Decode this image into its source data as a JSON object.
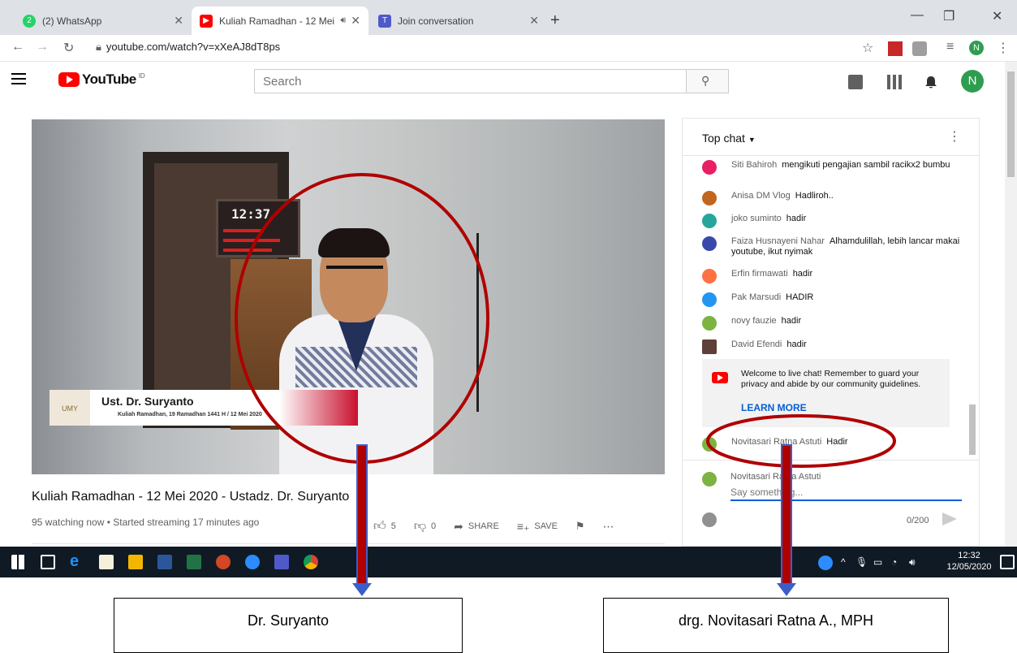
{
  "browser": {
    "tabs": [
      {
        "label": "(2) WhatsApp",
        "badge": "2"
      },
      {
        "label": "Kuliah Ramadhan - 12 Mei 2("
      },
      {
        "label": "Join conversation"
      }
    ],
    "url": "youtube.com/watch?v=xXeAJ8dT8ps",
    "profile_initial": "N"
  },
  "youtube": {
    "logo_text": "YouTube",
    "logo_region": "ID",
    "search_placeholder": "Search",
    "avatar_initial": "N"
  },
  "video": {
    "lower_third_name": "Ust. Dr. Suryanto",
    "lower_third_sub": "Kuliah Ramadhan, 19 Ramadhan 1441 H / 12 Mei 2020",
    "clock_text": "12:37",
    "badge_text": "UMY",
    "title": "Kuliah Ramadhan - 12 Mei 2020 - Ustadz. Dr. Suryanto",
    "meta": "95 watching now • Started streaming 17 minutes ago",
    "likes": "5",
    "dislikes": "0",
    "share_label": "SHARE",
    "save_label": "SAVE"
  },
  "chat": {
    "header": "Top chat",
    "messages": [
      {
        "author": "Siti Bahiroh",
        "text": "mengikuti pengajian sambil racikx2 bumbu",
        "color": "#e91e63"
      },
      {
        "author": "Anisa DM Vlog",
        "text": "Hadliroh..",
        "color": "#c1661f"
      },
      {
        "author": "joko suminto",
        "text": "hadir",
        "color": "#26a69a"
      },
      {
        "author": "Faiza Husnayeni Nahar",
        "text": "Alhamdulillah, lebih lancar makai youtube, ikut nyimak",
        "color": "#3949ab"
      },
      {
        "author": "Erfin firmawati",
        "text": "hadir",
        "color": "#ff7043"
      },
      {
        "author": "Pak Marsudi",
        "text": "HADIR",
        "color": "#2196f3"
      },
      {
        "author": "novy fauzie",
        "text": "hadir",
        "color": "#7cb342"
      },
      {
        "author": "David Efendi",
        "text": "hadir",
        "color": "#5d4037"
      },
      {
        "author": "Novitasari Ratna Astuti",
        "text": "Hadir",
        "color": "#7cb342"
      }
    ],
    "welcome_text": "Welcome to live chat! Remember to guard your privacy and abide by our community guidelines.",
    "learn_more": "LEARN MORE",
    "compose_user": "Novitasari Ratna Astuti",
    "compose_placeholder": "Say something...",
    "char_count": "0/200"
  },
  "taskbar": {
    "time": "12:32",
    "date": "12/05/2020"
  },
  "annotations": {
    "left_caption": "Dr. Suryanto",
    "right_caption": "drg. Novitasari Ratna A., MPH",
    "highlight_color": "#b00000",
    "arrow_color": "#3b5fc9"
  }
}
